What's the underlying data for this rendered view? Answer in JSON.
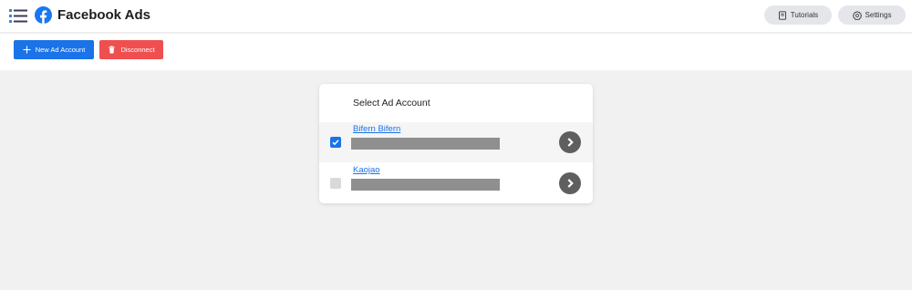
{
  "header": {
    "title": "Facebook Ads",
    "menu_icon": "hamburger-list-icon",
    "logo_icon": "facebook-logo-icon",
    "brand_color": "#1877f2",
    "tutorials_label": "Tutorials",
    "settings_label": "Settings"
  },
  "actions": {
    "new_account_label": "New Ad Account",
    "disconnect_label": "Disconnect",
    "new_account_color": "#1a73e8",
    "disconnect_color": "#ef4f4f"
  },
  "account_panel": {
    "title": "Select Ad Account",
    "accounts": [
      {
        "name": "Bifern Bifern",
        "checked": true
      },
      {
        "name": "Kaojao",
        "checked": false
      }
    ]
  }
}
